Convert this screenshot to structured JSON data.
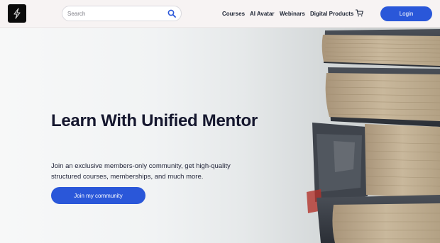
{
  "header": {
    "logo_icon": "lightning-bolt-icon",
    "search": {
      "placeholder": "Search",
      "value": "",
      "icon": "search-icon"
    },
    "nav": [
      "Courses",
      "AI Avatar",
      "Webinars",
      "Digital Products"
    ],
    "cart_icon": "shopping-cart-icon",
    "login_label": "Login"
  },
  "hero": {
    "title": "Learn With Unified Mentor",
    "description": "Join an exclusive members-only community, get high-quality structured courses, memberships, and much more.",
    "cta_label": "Join my community",
    "image": "stack-of-old-books"
  },
  "colors": {
    "accent": "#2a57d9",
    "heading": "#15172e",
    "header_bg": "#f7f3f3",
    "logo_bg": "#0b0b0b"
  }
}
